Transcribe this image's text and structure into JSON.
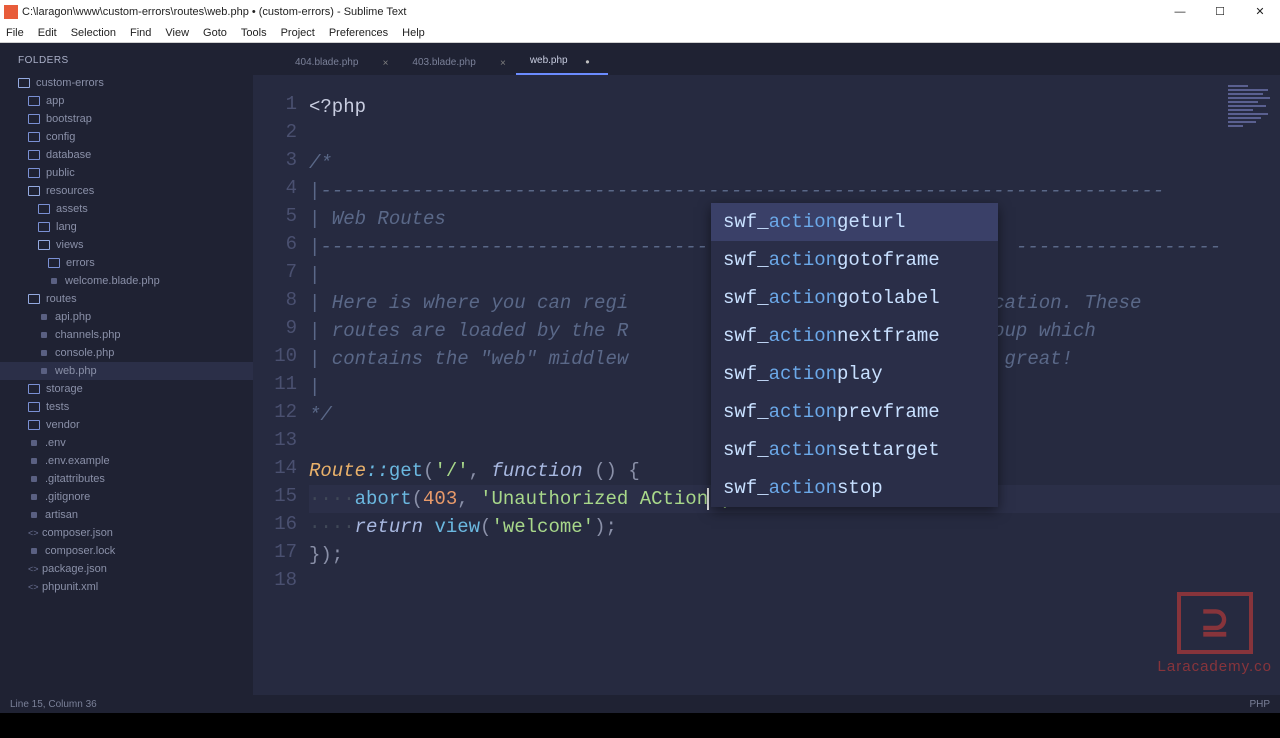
{
  "window": {
    "title": "C:\\laragon\\www\\custom-errors\\routes\\web.php • (custom-errors) - Sublime Text"
  },
  "menu": [
    "File",
    "Edit",
    "Selection",
    "Find",
    "View",
    "Goto",
    "Tools",
    "Project",
    "Preferences",
    "Help"
  ],
  "sidebar": {
    "title": "FOLDERS",
    "tree": [
      {
        "label": "custom-errors",
        "type": "folder-open",
        "indent": 0
      },
      {
        "label": "app",
        "type": "folder",
        "indent": 1
      },
      {
        "label": "bootstrap",
        "type": "folder",
        "indent": 1
      },
      {
        "label": "config",
        "type": "folder",
        "indent": 1
      },
      {
        "label": "database",
        "type": "folder",
        "indent": 1
      },
      {
        "label": "public",
        "type": "folder",
        "indent": 1
      },
      {
        "label": "resources",
        "type": "folder-open",
        "indent": 1
      },
      {
        "label": "assets",
        "type": "folder",
        "indent": 2
      },
      {
        "label": "lang",
        "type": "folder",
        "indent": 2
      },
      {
        "label": "views",
        "type": "folder-open",
        "indent": 2
      },
      {
        "label": "errors",
        "type": "folder",
        "indent": 3
      },
      {
        "label": "welcome.blade.php",
        "type": "file",
        "indent": 3
      },
      {
        "label": "routes",
        "type": "folder-open",
        "indent": 1
      },
      {
        "label": "api.php",
        "type": "file",
        "indent": 2
      },
      {
        "label": "channels.php",
        "type": "file",
        "indent": 2
      },
      {
        "label": "console.php",
        "type": "file",
        "indent": 2
      },
      {
        "label": "web.php",
        "type": "file",
        "indent": 2,
        "selected": true
      },
      {
        "label": "storage",
        "type": "folder",
        "indent": 1
      },
      {
        "label": "tests",
        "type": "folder",
        "indent": 1
      },
      {
        "label": "vendor",
        "type": "folder",
        "indent": 1
      },
      {
        "label": ".env",
        "type": "file",
        "indent": 1
      },
      {
        "label": ".env.example",
        "type": "file",
        "indent": 1
      },
      {
        "label": ".gitattributes",
        "type": "file",
        "indent": 1
      },
      {
        "label": ".gitignore",
        "type": "file",
        "indent": 1
      },
      {
        "label": "artisan",
        "type": "file",
        "indent": 1
      },
      {
        "label": "composer.json",
        "type": "code",
        "indent": 1
      },
      {
        "label": "composer.lock",
        "type": "file",
        "indent": 1
      },
      {
        "label": "package.json",
        "type": "code",
        "indent": 1
      },
      {
        "label": "phpunit.xml",
        "type": "code",
        "indent": 1
      }
    ]
  },
  "tabs": [
    {
      "label": "404.blade.php",
      "active": false
    },
    {
      "label": "403.blade.php",
      "active": false
    },
    {
      "label": "web.php",
      "active": true,
      "dirty": true
    }
  ],
  "code": {
    "line1_tag": "<?php",
    "line3": "/*",
    "line4": "|--------------------------------------------------------------------------",
    "line5": "| Web Routes",
    "line6": "|------------------------------------",
    "line6b": "------------------",
    "line7": "|",
    "line8a": "| Here is where you can regi",
    "line8b": "r application. These",
    "line9a": "| routes are loaded by the R",
    "line9b": "in a group which",
    "line10a": "| contains the \"web\" middlew",
    "line10b": "mething great!",
    "line11": "|",
    "line12": "*/",
    "l14_route": "Route",
    "l14_get": "get",
    "l14_slash": "'/'",
    "l14_function": "function",
    "l15_abort": "abort",
    "l15_code": "403",
    "l15_msg": "'Unauthorized ACtion",
    "l15_end": "')",
    "l16_return": "return",
    "l16_view": "view",
    "l16_welcome": "'welcome'"
  },
  "autocomplete": [
    {
      "pre": "swf_",
      "hl": "action",
      "post": "geturl",
      "selected": true
    },
    {
      "pre": "swf_",
      "hl": "action",
      "post": "gotoframe"
    },
    {
      "pre": "swf_",
      "hl": "action",
      "post": "gotolabel"
    },
    {
      "pre": "swf_",
      "hl": "action",
      "post": "nextframe"
    },
    {
      "pre": "swf_",
      "hl": "action",
      "post": "play"
    },
    {
      "pre": "swf_",
      "hl": "action",
      "post": "prevframe"
    },
    {
      "pre": "swf_",
      "hl": "action",
      "post": "settarget"
    },
    {
      "pre": "swf_",
      "hl": "action",
      "post": "stop"
    }
  ],
  "status": {
    "left": "Line 15, Column 36",
    "right": "PHP"
  },
  "watermark": "Laracademy.co"
}
